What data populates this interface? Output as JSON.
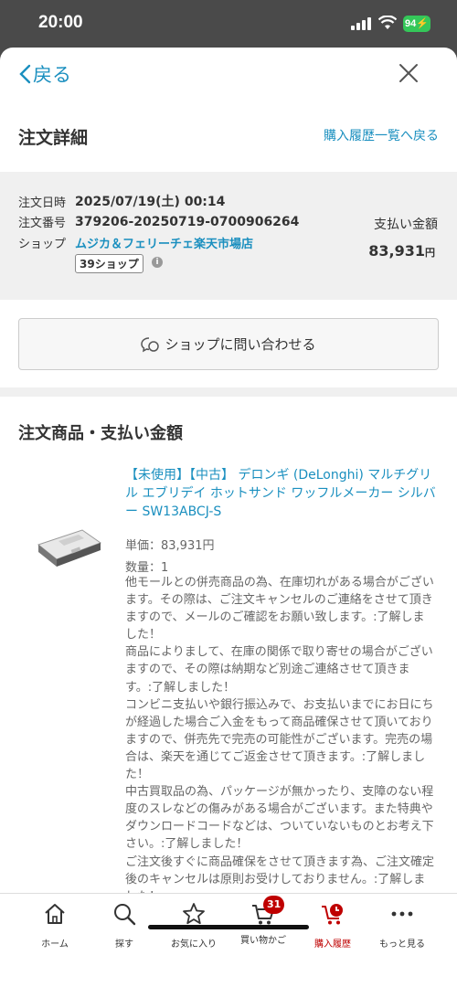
{
  "status": {
    "time": "20:00",
    "battery": "94"
  },
  "nav": {
    "back_label": "戻る"
  },
  "header": {
    "title": "注文詳細",
    "history_link": "購入履歴一覧へ戻る"
  },
  "order": {
    "date_label": "注文日時",
    "date": "2025/07/19(土) 00:14",
    "number_label": "注文番号",
    "number": "379206-20250719-0700906264",
    "shop_label": "ショップ",
    "shop": "ムジカ＆フェリーチェ楽天市場店",
    "shop_badge": "39ショップ",
    "payment_label": "支払い金額",
    "payment": "83,931",
    "payment_unit": "円"
  },
  "contact_button": "ショップに問い合わせる",
  "section_title": "注文商品・支払い金額",
  "product": {
    "name": "【未使用】【中古】 デロンギ (DeLonghi) マルチグリル エブリデイ ホットサンド ワッフルメーカー シルバー SW13ABCJ-S",
    "unit_price": "単価：83,931円",
    "quantity": "数量：1",
    "remarks": "他モールとの併売商品の為、在庫切れがある場合がございます。その際は、ご注文キャンセルのご連絡をさせて頂きますので、メールのご確認をお願い致します。:了解しました！\n商品によりまして、在庫の関係で取り寄せの場合がございますので、その際は納期など別途ご連絡させて頂きます。:了解しました！\nコンビニ支払いや銀行振込みで、お支払いまでにお日にちが経過した場合ご入金をもって商品確保させて頂いておりますので、併売先で完売の可能性がございます。完売の場合は、楽天を通じてご返金させて頂きます。:了解しました！\n中古買取品の為、パッケージが無かったり、支障のない程度のスレなどの傷みがある場合がございます。また特典やダウンロードコードなどは、ついていないものとお考え下さい。:了解しました！\nご注文後すぐに商品確保をさせて頂きます為、ご注文確定後のキャンセルは原則お受けしておりません。:了解しました！"
  },
  "tabs": [
    {
      "label": "ホーム",
      "icon": "home-icon"
    },
    {
      "label": "探す",
      "icon": "search-icon"
    },
    {
      "label": "お気に入り",
      "icon": "star-icon"
    },
    {
      "label": "買い物かご",
      "icon": "cart-icon",
      "badge": "31"
    },
    {
      "label": "購入履歴",
      "icon": "purchase-history-icon",
      "active": true
    },
    {
      "label": "もっと見る",
      "icon": "more-icon"
    }
  ],
  "colors": {
    "link": "#1a8fbf",
    "accent": "#bf0000",
    "battery": "#34c759"
  }
}
